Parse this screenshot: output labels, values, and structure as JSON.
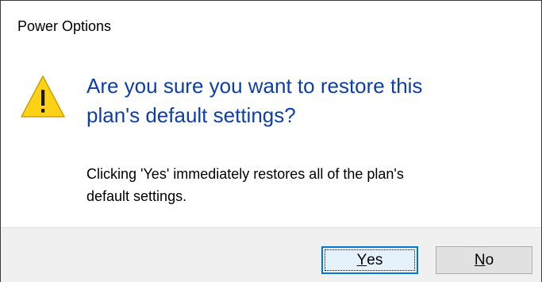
{
  "window": {
    "title": "Power Options"
  },
  "message": {
    "icon": "warning-icon",
    "main_instruction_line1": "Are you sure you want to restore this",
    "main_instruction_line2": "plan's default settings?",
    "content_line1": "Clicking 'Yes' immediately restores all of the plan's",
    "content_line2": "default settings."
  },
  "buttons": {
    "yes_accel": "Y",
    "yes_rest": "es",
    "no_accel": "N",
    "no_rest": "o"
  },
  "colors": {
    "main_instruction": "#0f3ea9",
    "footer_background": "#f0f0f0",
    "default_button_border": "#0078d7",
    "warning_fill": "#fcd116"
  }
}
